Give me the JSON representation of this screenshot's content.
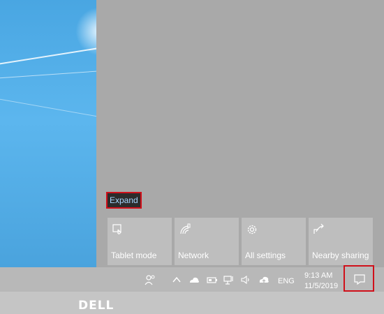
{
  "action_center": {
    "expand_label": "Expand",
    "tiles": [
      {
        "label": "Tablet mode",
        "icon": "tablet-mode-icon"
      },
      {
        "label": "Network",
        "icon": "network-icon"
      },
      {
        "label": "All settings",
        "icon": "gear-icon"
      },
      {
        "label": "Nearby sharing",
        "icon": "nearby-sharing-icon"
      }
    ]
  },
  "taskbar": {
    "language": "ENG",
    "time": "9:13 AM",
    "date": "11/5/2019",
    "tray_icons": [
      "people-icon",
      "chevron-up-icon",
      "onedrive-icon",
      "battery-icon",
      "network-wired-icon",
      "volume-icon",
      "upload-icon"
    ]
  },
  "bezel": {
    "logo_text": "DELL"
  },
  "colors": {
    "panel": "#a9a9a9",
    "tile": "#bebebe",
    "highlight": "#d0101a",
    "link": "#a6d7ff",
    "wallpaper": "#49a6e2"
  }
}
